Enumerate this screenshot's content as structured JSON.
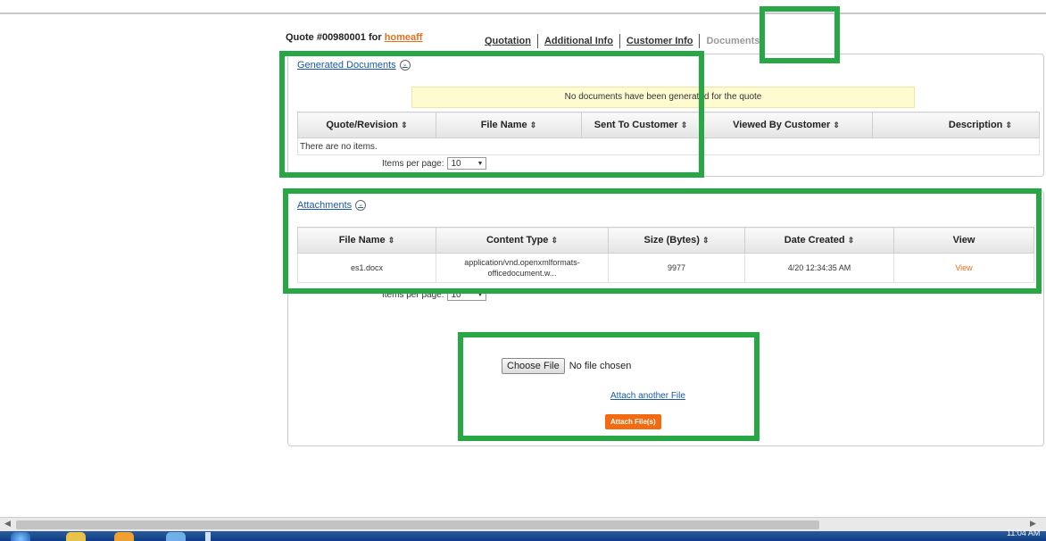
{
  "header": {
    "title": "Quote #00980001 for",
    "customer_link": "homeaff"
  },
  "tabs": [
    {
      "label": "Quotation",
      "active": false
    },
    {
      "label": "Additional Info",
      "active": false
    },
    {
      "label": "Customer Info",
      "active": false
    },
    {
      "label": "Documents",
      "active": true
    }
  ],
  "generated": {
    "title": "Generated Documents",
    "message": "No documents have been generated for the quote",
    "columns": [
      "Quote/Revision",
      "File Name",
      "Sent To Customer",
      "Viewed By Customer",
      "Description"
    ],
    "empty_text": "There are no items.",
    "items_per_page_label": "Items per page:",
    "items_per_page_value": "10"
  },
  "attachments": {
    "title": "Attachments",
    "columns": [
      "File Name",
      "Content Type",
      "Size (Bytes)",
      "Date Created",
      "View"
    ],
    "rows": [
      {
        "file_name": "es1.docx",
        "content_type_line1": "application/vnd.openxmlformats-",
        "content_type_line2": "officedocument.w...",
        "size": "9977",
        "date": "4/20 12:34:35 AM",
        "view": "View"
      }
    ],
    "items_per_page_label": "Items per page:",
    "items_per_page_value": "10"
  },
  "upload": {
    "choose_button": "Choose File",
    "no_file": "No file chosen",
    "attach_another": "Attach another File",
    "attach_button": "Attach File(s)"
  },
  "taskbar": {
    "time": "11:04 AM"
  },
  "colors": {
    "accent_orange": "#e8701a",
    "link_blue": "#1a5aa8",
    "highlight_green": "#27a844",
    "message_bg": "#fffbd0"
  }
}
